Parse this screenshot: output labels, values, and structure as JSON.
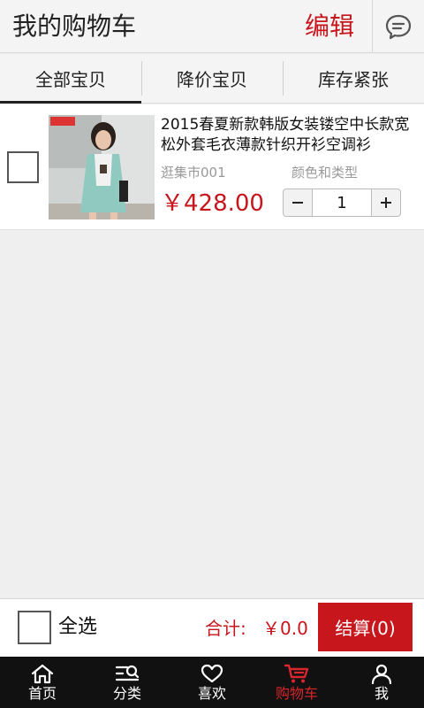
{
  "header": {
    "title": "我的购物车",
    "edit_label": "编辑",
    "message_icon": "chat-bubble-icon"
  },
  "tabs": [
    {
      "label": "全部宝贝",
      "active": true
    },
    {
      "label": "降价宝贝",
      "active": false
    },
    {
      "label": "库存紧张",
      "active": false
    }
  ],
  "cart": {
    "items": [
      {
        "title": "2015春夏新款韩版女装镂空中长款宽松外套毛衣薄款针织开衫空调衫",
        "shop": "逛集市001",
        "variant_label": "颜色和类型",
        "price": "￥428.00",
        "quantity": "1",
        "checked": false
      }
    ]
  },
  "footer": {
    "select_all_label": "全选",
    "total_label": "合计:",
    "total_value": "￥0.0",
    "checkout_label": "结算(0)"
  },
  "nav": [
    {
      "label": "首页",
      "icon": "home-icon",
      "active": false
    },
    {
      "label": "分类",
      "icon": "category-search-icon",
      "active": false
    },
    {
      "label": "喜欢",
      "icon": "heart-icon",
      "active": false
    },
    {
      "label": "购物车",
      "icon": "cart-icon",
      "active": true
    },
    {
      "label": "我",
      "icon": "user-icon",
      "active": false
    }
  ],
  "colors": {
    "accent": "#c8161d",
    "nav_bg": "#111111",
    "page_bg": "#efefef"
  }
}
